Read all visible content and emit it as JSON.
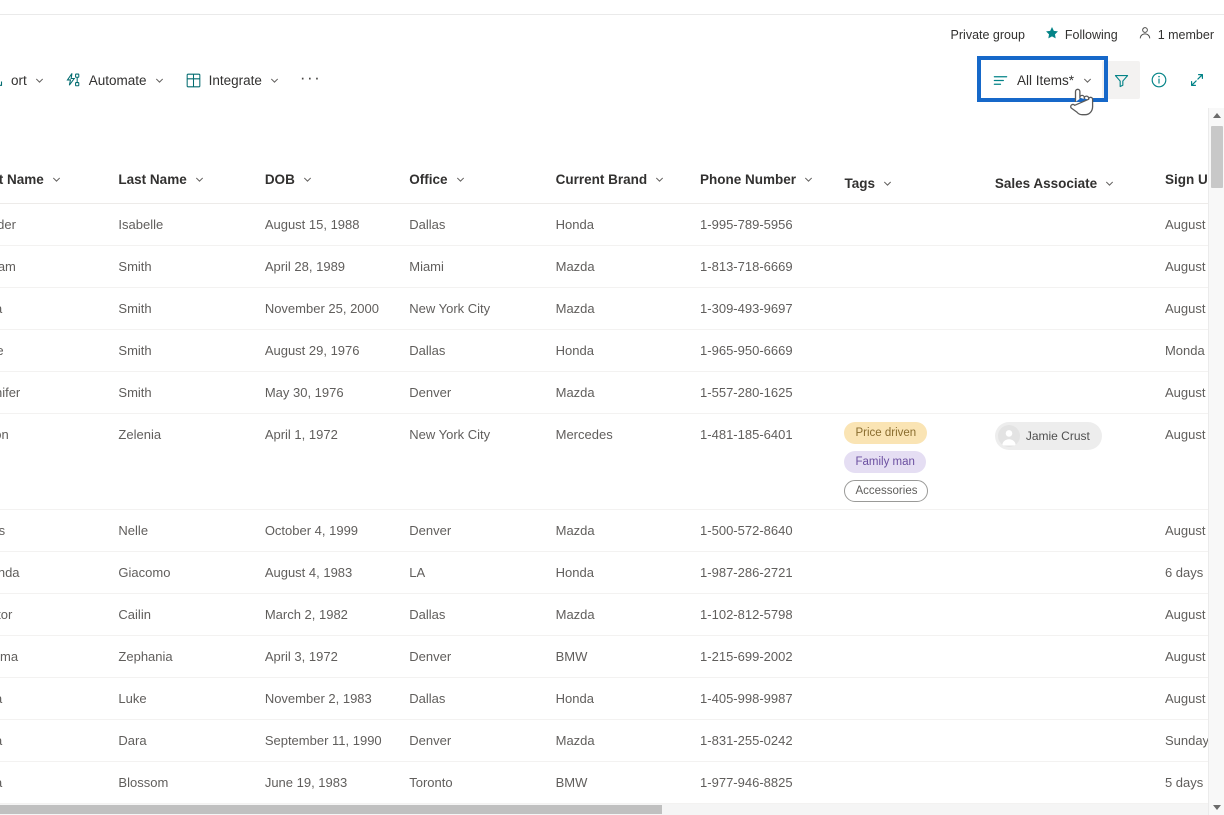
{
  "header": {
    "privacy_label": "Private group",
    "following_label": "Following",
    "members_label": "1 member"
  },
  "command_bar": {
    "left_items": [
      {
        "label": "ort",
        "icon": "export-icon",
        "has_chevron": true,
        "clipped": true
      },
      {
        "label": "Automate",
        "icon": "automate-icon",
        "has_chevron": true,
        "clipped": false
      },
      {
        "label": "Integrate",
        "icon": "integrate-icon",
        "has_chevron": true,
        "clipped": false
      }
    ],
    "overflow_label": "···",
    "view_selector": {
      "label": "All Items*",
      "icon": "list-view-icon",
      "chevron": "chevron-down-icon",
      "highlight_color": "#1668c9"
    },
    "right_icons": [
      {
        "name": "filter-icon",
        "color": "#038387"
      },
      {
        "name": "info-icon",
        "color": "#038387"
      },
      {
        "name": "expand-icon",
        "color": "#038387"
      }
    ]
  },
  "table": {
    "columns": [
      {
        "key": "first_name",
        "label": "First Name",
        "class": "c-first"
      },
      {
        "key": "last_name",
        "label": "Last Name",
        "class": "c-last"
      },
      {
        "key": "dob",
        "label": "DOB",
        "class": "c-dob"
      },
      {
        "key": "office",
        "label": "Office",
        "class": "c-office"
      },
      {
        "key": "current_brand",
        "label": "Current Brand",
        "class": "c-brand"
      },
      {
        "key": "phone_number",
        "label": "Phone Number",
        "class": "c-phone"
      },
      {
        "key": "tags",
        "label": "Tags",
        "class": "c-tags"
      },
      {
        "key": "sales_associate",
        "label": "Sales Associate",
        "class": "c-assoc"
      },
      {
        "key": "sign_up",
        "label": "Sign U",
        "class": "c-signup"
      }
    ],
    "rows": [
      {
        "first_name": "Xander",
        "last_name": "Isabelle",
        "dob": "August 15, 1988",
        "office": "Dallas",
        "current_brand": "Honda",
        "phone_number": "1-995-789-5956",
        "tags": [],
        "sales_associate": "",
        "sign_up": "August"
      },
      {
        "first_name": "William",
        "last_name": "Smith",
        "dob": "April 28, 1989",
        "office": "Miami",
        "current_brand": "Mazda",
        "phone_number": "1-813-718-6669",
        "tags": [],
        "sales_associate": "",
        "sign_up": "August"
      },
      {
        "first_name": "Cora",
        "last_name": "Smith",
        "dob": "November 25, 2000",
        "office": "New York City",
        "current_brand": "Mazda",
        "phone_number": "1-309-493-9697",
        "tags": [],
        "sales_associate": "",
        "sign_up": "August"
      },
      {
        "first_name": "Price",
        "last_name": "Smith",
        "dob": "August 29, 1976",
        "office": "Dallas",
        "current_brand": "Honda",
        "phone_number": "1-965-950-6669",
        "tags": [],
        "sales_associate": "",
        "sign_up": "Monda"
      },
      {
        "first_name": "Jennifer",
        "last_name": "Smith",
        "dob": "May 30, 1976",
        "office": "Denver",
        "current_brand": "Mazda",
        "phone_number": "1-557-280-1625",
        "tags": [],
        "sales_associate": "",
        "sign_up": "August"
      },
      {
        "first_name": "Jason",
        "last_name": "Zelenia",
        "dob": "April 1, 1972",
        "office": "New York City",
        "current_brand": "Mercedes",
        "phone_number": "1-481-185-6401",
        "tags": [
          {
            "label": "Price driven",
            "style": "amber"
          },
          {
            "label": "Family man",
            "style": "purple"
          },
          {
            "label": "Accessories",
            "style": "plain"
          }
        ],
        "sales_associate": "Jamie Crust",
        "sign_up": "August",
        "tall": true
      },
      {
        "first_name": "Linus",
        "last_name": "Nelle",
        "dob": "October 4, 1999",
        "office": "Denver",
        "current_brand": "Mazda",
        "phone_number": "1-500-572-8640",
        "tags": [],
        "sales_associate": "",
        "sign_up": "August"
      },
      {
        "first_name": "Chanda",
        "last_name": "Giacomo",
        "dob": "August 4, 1983",
        "office": "LA",
        "current_brand": "Honda",
        "phone_number": "1-987-286-2721",
        "tags": [],
        "sales_associate": "",
        "sign_up": "6 days"
      },
      {
        "first_name": "Hector",
        "last_name": "Cailin",
        "dob": "March 2, 1982",
        "office": "Dallas",
        "current_brand": "Mazda",
        "phone_number": "1-102-812-5798",
        "tags": [],
        "sales_associate": "",
        "sign_up": "August"
      },
      {
        "first_name": "Paloma",
        "last_name": "Zephania",
        "dob": "April 3, 1972",
        "office": "Denver",
        "current_brand": "BMW",
        "phone_number": "1-215-699-2002",
        "tags": [],
        "sales_associate": "",
        "sign_up": "August"
      },
      {
        "first_name": "Cora",
        "last_name": "Luke",
        "dob": "November 2, 1983",
        "office": "Dallas",
        "current_brand": "Honda",
        "phone_number": "1-405-998-9987",
        "tags": [],
        "sales_associate": "",
        "sign_up": "August"
      },
      {
        "first_name": "Cora",
        "last_name": "Dara",
        "dob": "September 11, 1990",
        "office": "Denver",
        "current_brand": "Mazda",
        "phone_number": "1-831-255-0242",
        "tags": [],
        "sales_associate": "",
        "sign_up": "Sunday"
      },
      {
        "first_name": "Cora",
        "last_name": "Blossom",
        "dob": "June 19, 1983",
        "office": "Toronto",
        "current_brand": "BMW",
        "phone_number": "1-977-946-8825",
        "tags": [],
        "sales_associate": "",
        "sign_up": "5 days"
      }
    ]
  }
}
